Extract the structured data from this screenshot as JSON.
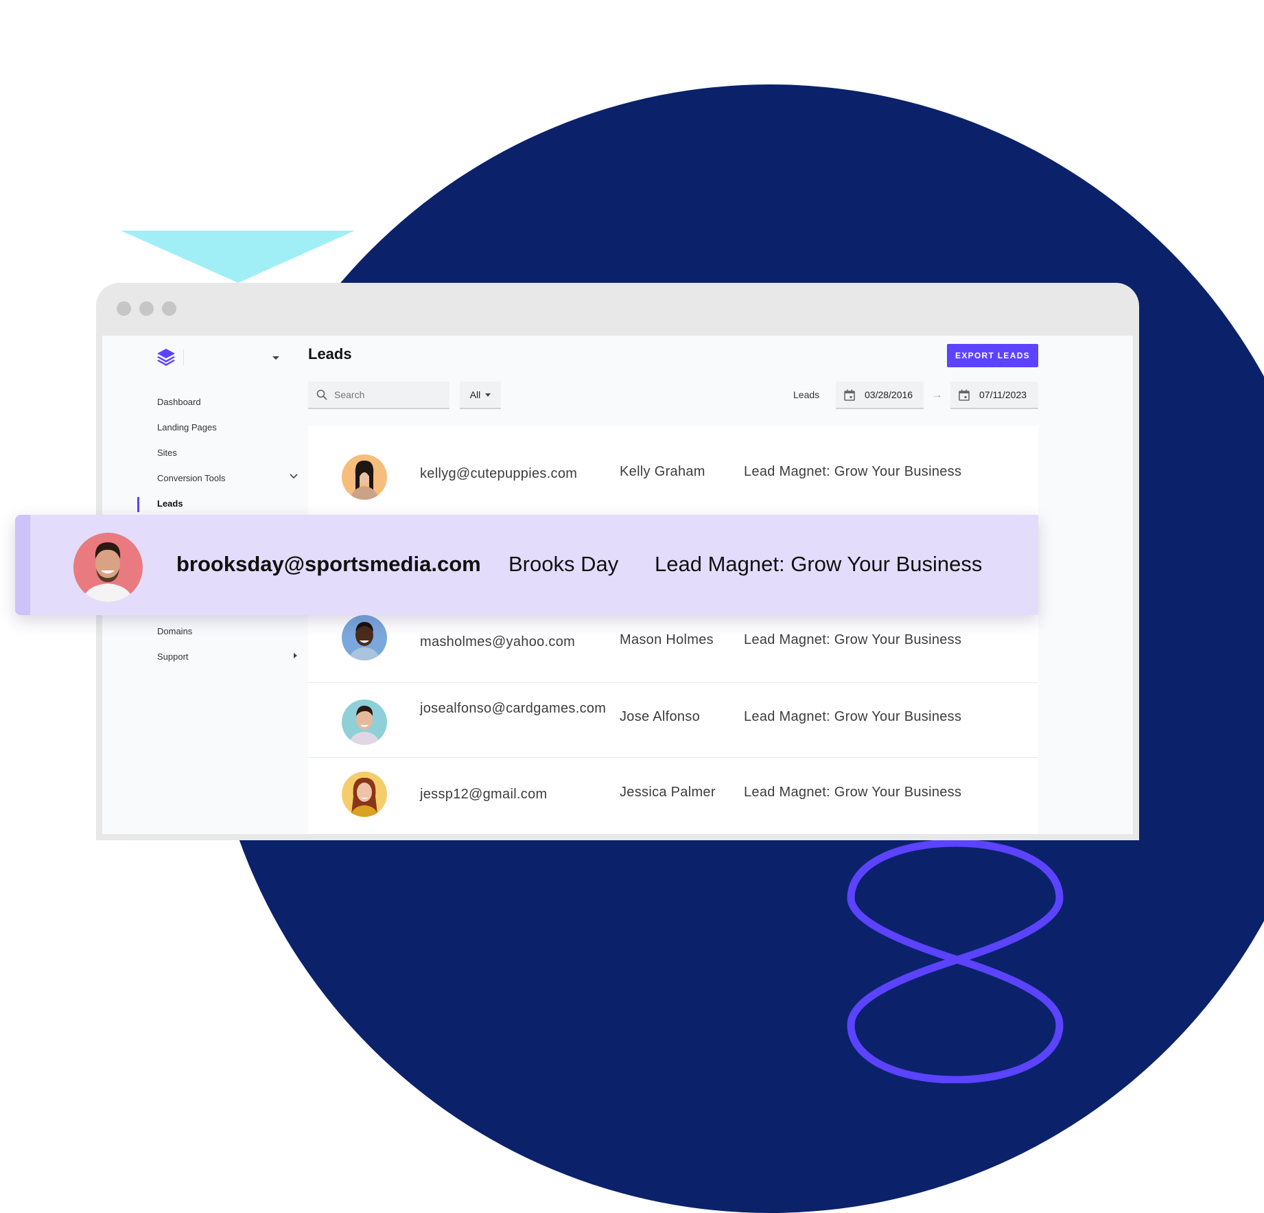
{
  "colors": {
    "accent": "#5b43ff",
    "navy_background": "#0b226b",
    "cyan_triangle": "#a0eff6",
    "highlight_row": "#e3dcfb"
  },
  "window": {
    "controls": [
      "close",
      "minimize",
      "maximize"
    ]
  },
  "sidebar": {
    "logo_icon": "layers-icon",
    "items": [
      {
        "label": "Dashboard"
      },
      {
        "label": "Landing Pages"
      },
      {
        "label": "Sites"
      },
      {
        "label": "Conversion Tools",
        "icon": "chevron-down-icon"
      },
      {
        "label": "Leads",
        "active": true
      }
    ],
    "lower_items": [
      {
        "label": "Domains"
      },
      {
        "label": "Support",
        "icon": "caret-right-icon"
      }
    ]
  },
  "header": {
    "title": "Leads",
    "export_label": "EXPORT LEADS"
  },
  "filters": {
    "search_placeholder": "Search",
    "filter_value": "All",
    "date_label": "Leads",
    "date_from": "03/28/2016",
    "date_to": "07/11/2023"
  },
  "leads": [
    {
      "email": "kellyg@cutepuppies.com",
      "name": "Kelly Graham",
      "source": "Lead Magnet: Grow Your Business",
      "avatar_bg": "#f6bd7c"
    },
    {
      "email": "masholmes@yahoo.com",
      "name": "Mason Holmes",
      "source": "Lead Magnet: Grow Your Business",
      "avatar_bg": "#7aa7dc"
    },
    {
      "email": "josealfonso@cardgames.com",
      "name": "Jose Alfonso",
      "source": "Lead Magnet: Grow Your Business",
      "avatar_bg": "#8fd0d8"
    },
    {
      "email": "jessp12@gmail.com",
      "name": "Jessica Palmer",
      "source": "Lead Magnet: Grow Your Business",
      "avatar_bg": "#f6cd6b"
    }
  ],
  "highlighted_lead": {
    "email": "brooksday@sportsmedia.com",
    "name": "Brooks Day",
    "source": "Lead Magnet: Grow Your Business",
    "avatar_bg": "#e97b80"
  }
}
